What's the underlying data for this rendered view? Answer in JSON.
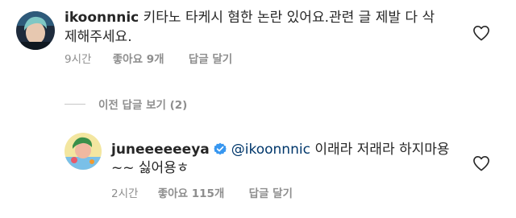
{
  "comments": [
    {
      "username": "ikoonnnic",
      "text_line1": "키타노 타케시 혐한 논란 있어요.관련 글 제발 다 삭",
      "text_line2": "제해주세요.",
      "time": "9시간",
      "likes": "좋아요 9개",
      "reply": "답글 달기"
    }
  ],
  "view_replies": "이전 답글 보기 (2)",
  "reply": {
    "username": "juneeeeeeya",
    "verified": true,
    "mention": "@ikoonnnic",
    "text_line1": "이래라 저래라 하지마용",
    "text_line2": "~~ 싫어용ㅎ",
    "time": "2시간",
    "likes": "좋아요 115개",
    "reply": "답글 달기"
  },
  "colors": {
    "text": "#262626",
    "secondary": "#8e8e8e",
    "mention": "#00376b",
    "verified": "#3897f0"
  },
  "icons": {
    "like": "heart-outline-icon",
    "verified": "verified-badge-icon"
  }
}
